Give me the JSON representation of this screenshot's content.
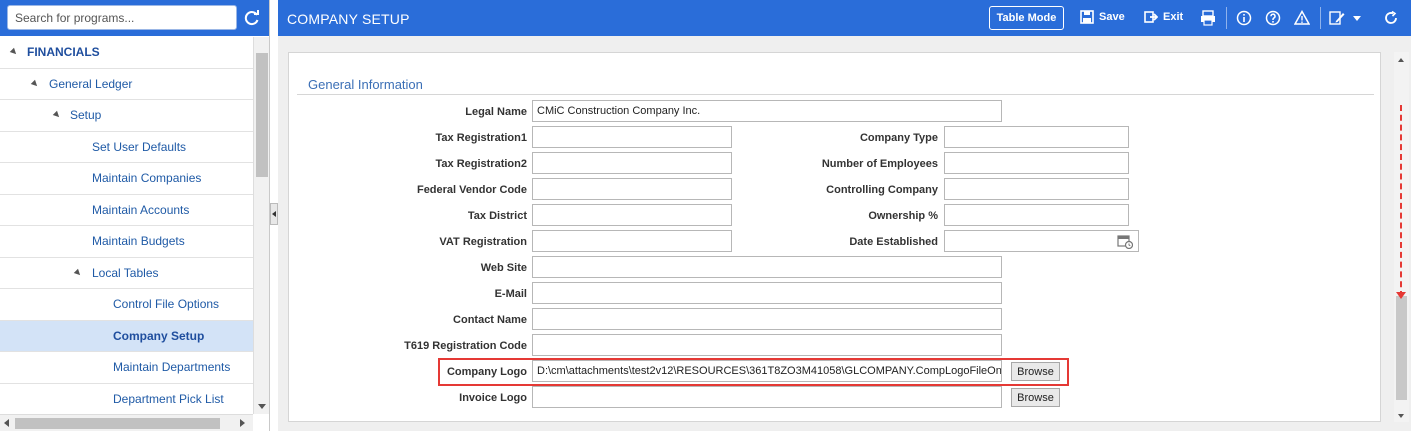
{
  "search": {
    "placeholder": "Search for programs..."
  },
  "sidebar": {
    "items": [
      {
        "label": "FINANCIALS",
        "level": 0
      },
      {
        "label": "General Ledger",
        "level": 1
      },
      {
        "label": "Setup",
        "level": 2
      },
      {
        "label": "Set User Defaults",
        "level": 3
      },
      {
        "label": "Maintain Companies",
        "level": 3
      },
      {
        "label": "Maintain Accounts",
        "level": 3
      },
      {
        "label": "Maintain Budgets",
        "level": 3
      },
      {
        "label": "Local Tables",
        "level": 3
      },
      {
        "label": "Control File Options",
        "level": 4
      },
      {
        "label": "Company Setup",
        "level": 4,
        "selected": true
      },
      {
        "label": "Maintain Departments",
        "level": 4
      },
      {
        "label": "Department Pick List",
        "level": 4
      }
    ]
  },
  "header": {
    "title": "COMPANY SETUP",
    "table_mode_label": "Table Mode",
    "save_label": "Save",
    "exit_label": "Exit"
  },
  "form": {
    "section_title": "General Information",
    "legal_name": {
      "label": "Legal Name",
      "value": "CMiC Construction Company Inc."
    },
    "tax_registration1": {
      "label": "Tax Registration1",
      "value": ""
    },
    "tax_registration2": {
      "label": "Tax Registration2",
      "value": ""
    },
    "federal_vendor_code": {
      "label": "Federal Vendor Code",
      "value": ""
    },
    "tax_district": {
      "label": "Tax District",
      "value": ""
    },
    "vat_registration": {
      "label": "VAT Registration",
      "value": ""
    },
    "web_site": {
      "label": "Web Site",
      "value": ""
    },
    "email": {
      "label": "E-Mail",
      "value": ""
    },
    "contact_name": {
      "label": "Contact Name",
      "value": ""
    },
    "t619_registration_code": {
      "label": "T619 Registration Code",
      "value": ""
    },
    "company_logo": {
      "label": "Company Logo",
      "value": "D:\\cm\\attachments\\test2v12\\RESOURCES\\361T8ZO3M41058\\GLCOMPANY.CompLogoFileOn\\"
    },
    "invoice_logo": {
      "label": "Invoice Logo",
      "value": ""
    },
    "company_type": {
      "label": "Company Type",
      "value": ""
    },
    "number_of_employees": {
      "label": "Number of Employees",
      "value": ""
    },
    "controlling_company": {
      "label": "Controlling Company",
      "value": ""
    },
    "ownership_pct": {
      "label": "Ownership %",
      "value": ""
    },
    "date_established": {
      "label": "Date Established",
      "value": ""
    },
    "browse_label": "Browse"
  },
  "colors": {
    "header_blue": "#2a6dd9",
    "link_blue": "#1f5aa6",
    "highlight_red": "#e53935",
    "selected_row": "#d3e3f7"
  }
}
